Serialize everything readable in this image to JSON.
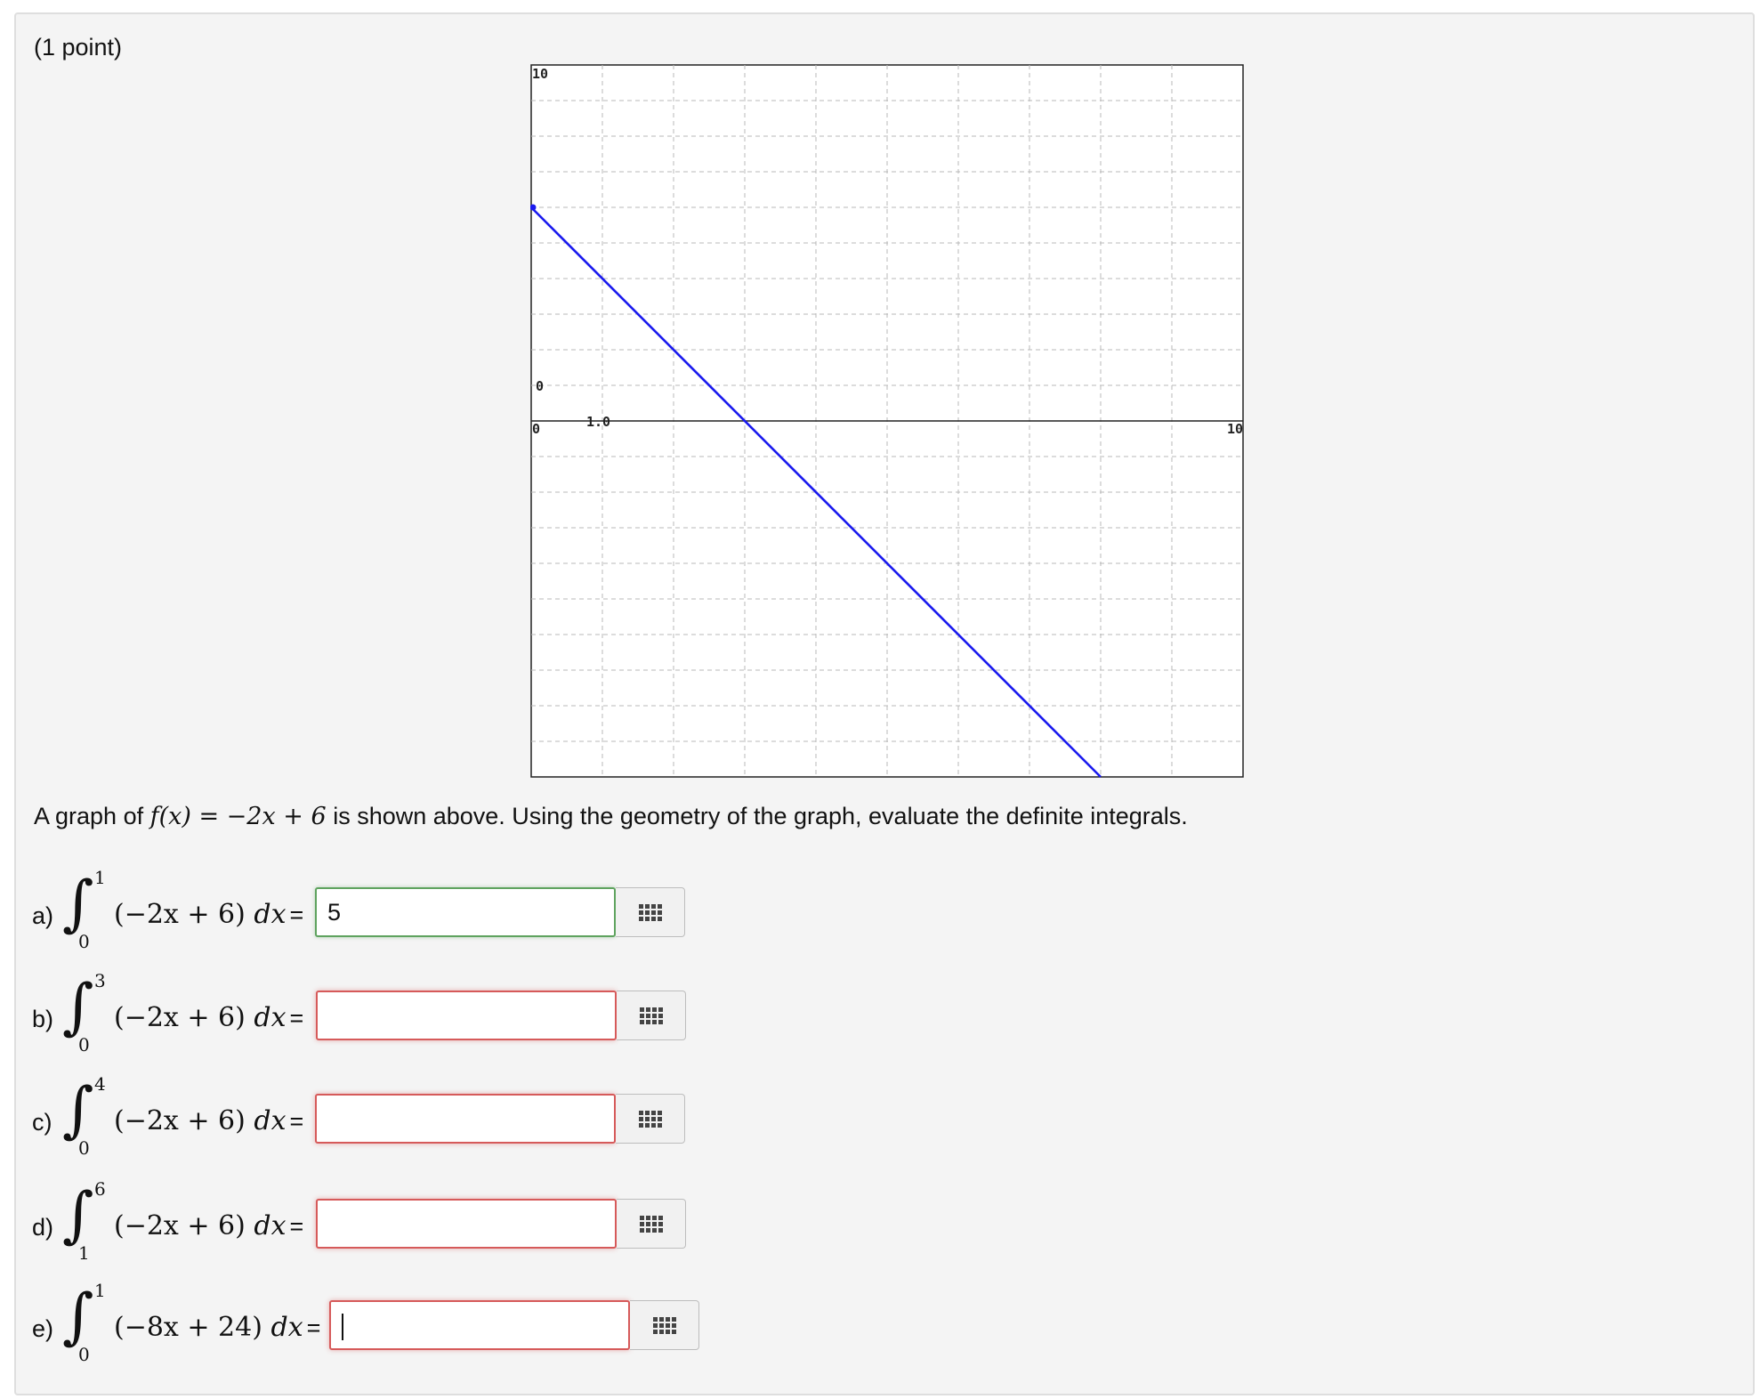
{
  "problem": {
    "points_label": "(1 point)",
    "prompt_before": "A graph of ",
    "prompt_function": "f(x) = −2x + 6",
    "prompt_after": " is shown above. Using the geometry of the graph, evaluate the definite integrals."
  },
  "graph": {
    "x_range": [
      0,
      10
    ],
    "y_range": [
      -10,
      10
    ],
    "grid": true,
    "line_color": "#1a1aee",
    "function": {
      "slope": -2,
      "intercept": 6
    },
    "tick_labels": {
      "y_top": "10",
      "y_mid": "0",
      "x_origin": "0",
      "x_tick": "1.0",
      "x_right": "10"
    }
  },
  "questions": [
    {
      "label": "a)",
      "upper": "1",
      "lower": "0",
      "integrand": "(−2x + 6)",
      "dx": "dx",
      "equals": "=",
      "value": "5",
      "status": "correct",
      "focused": false
    },
    {
      "label": "b)",
      "upper": "3",
      "lower": "0",
      "integrand": "(−2x + 6)",
      "dx": "dx",
      "equals": "=",
      "value": "",
      "status": "incorrect",
      "focused": false
    },
    {
      "label": "c)",
      "upper": "4",
      "lower": "0",
      "integrand": "(−2x + 6)",
      "dx": "dx",
      "equals": "=",
      "value": "",
      "status": "incorrect",
      "focused": false
    },
    {
      "label": "d)",
      "upper": "6",
      "lower": "1",
      "integrand": "(−2x + 6)",
      "dx": "dx",
      "equals": "=",
      "value": "",
      "status": "incorrect",
      "focused": false
    },
    {
      "label": "e)",
      "upper": "1",
      "lower": "0",
      "integrand": "(−8x + 24)",
      "dx": "dx",
      "equals": "=",
      "value": "",
      "status": "incorrect",
      "focused": true
    }
  ],
  "icons": {
    "equation_editor": "keypad-grid-icon",
    "integral": "integral-sign-icon"
  }
}
